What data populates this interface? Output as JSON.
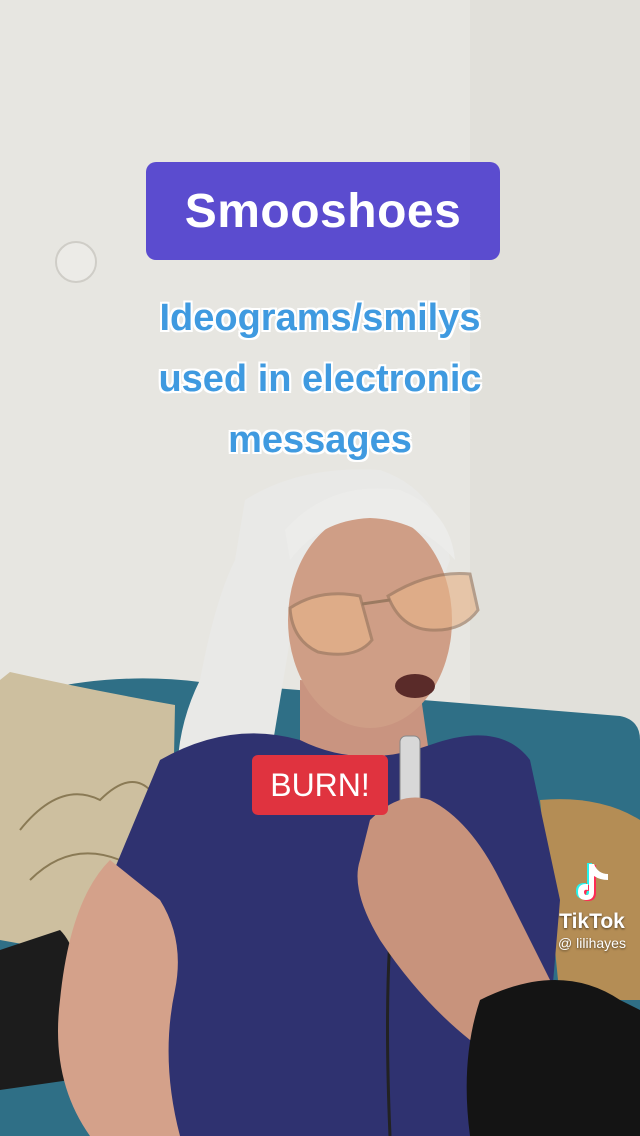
{
  "overlay": {
    "title": "Smooshoes",
    "subtitle_lines": [
      "Ideograms/smilys",
      "used in electronic",
      "messages"
    ],
    "burn_label": "BURN!"
  },
  "watermark": {
    "brand": "TikTok",
    "handle": "@ lilihayes"
  },
  "colors": {
    "title_badge": "#5b4ccf",
    "subtitle_text": "#3f9ae0",
    "burn_badge": "#e0333f",
    "wall": "#e9e8e3",
    "sofa": "#2f6f86",
    "shirt": "#2f3270"
  }
}
